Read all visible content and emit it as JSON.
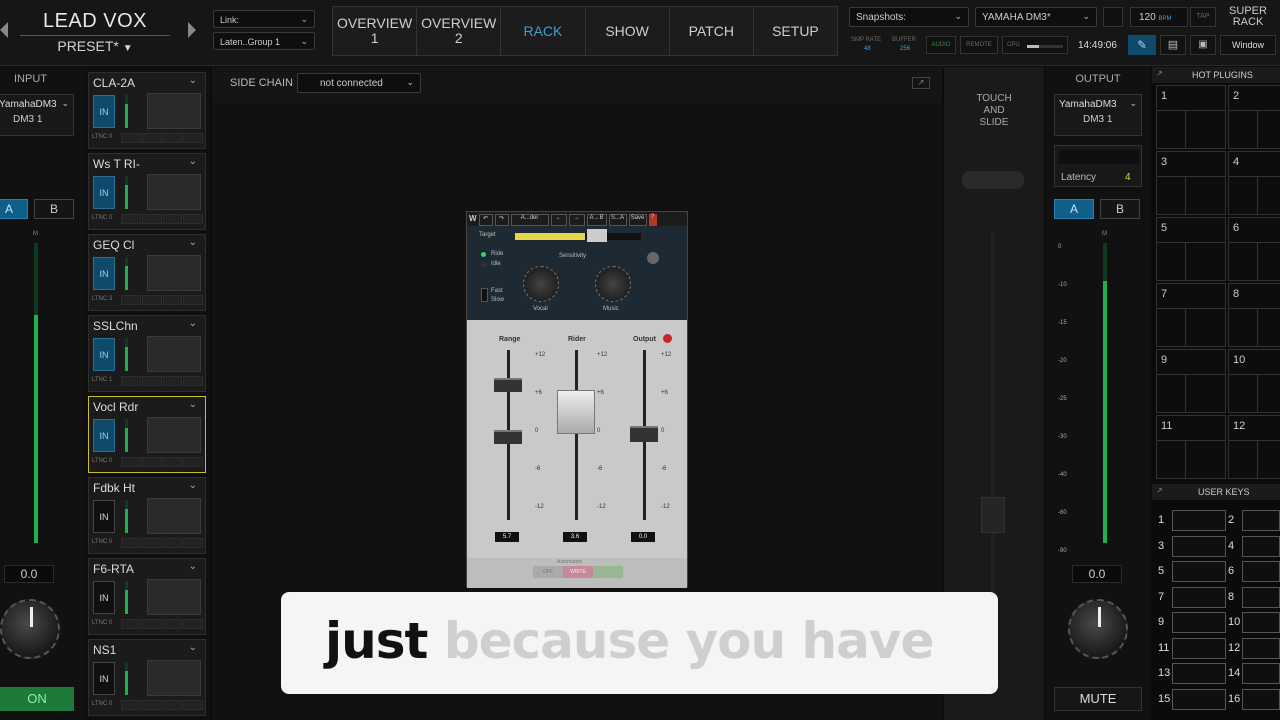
{
  "header": {
    "preset_title": "LEAD VOX",
    "preset_sub": "PRESET*",
    "link_label": "Link:",
    "link_value": "Laten..Group 1",
    "tabs": [
      {
        "line1": "OVERVIEW",
        "line2": "1"
      },
      {
        "line1": "OVERVIEW",
        "line2": "2"
      },
      {
        "line1": "RACK",
        "line2": ""
      },
      {
        "line1": "SHOW",
        "line2": ""
      },
      {
        "line1": "PATCH",
        "line2": ""
      },
      {
        "line1": "SETUP",
        "line2": ""
      }
    ],
    "snapshots_label": "Snapshots:",
    "device_label": "YAMAHA DM3*",
    "bpm_value": "120",
    "bpm_label": "BPM",
    "tap_label": "TAP",
    "super_rack_l1": "SUPER",
    "super_rack_l2": "RACK",
    "smp_rate_label": "SMP RATE",
    "smp_rate_value": "48",
    "buffer_label": "BUFFER",
    "buffer_value": "256",
    "audio_label": "AUDIO",
    "remote_label": "REMOTE",
    "cpu_label": "CPU",
    "clock": "14:49:06",
    "window_label": "Window"
  },
  "input": {
    "title": "INPUT",
    "device": "YamahaDM3",
    "device_sub": "DM3 1",
    "a_label": "A",
    "b_label": "B",
    "m_label": "M",
    "gain": "0.0",
    "on_label": "ON"
  },
  "rack": {
    "in_label": "IN",
    "slots": [
      {
        "name": "CLA-2A",
        "ltnc": "LTNC 0"
      },
      {
        "name": "Ws T RI-",
        "ltnc": "LTNC 0"
      },
      {
        "name": "GEQ Cl",
        "ltnc": "LTNC 3"
      },
      {
        "name": "SSLChn",
        "ltnc": "LTNC 1"
      },
      {
        "name": "Vocl Rdr",
        "ltnc": "LTNC 0"
      },
      {
        "name": "Fdbk Ht",
        "ltnc": "LTNC 0"
      },
      {
        "name": "F6-RTA",
        "ltnc": "LTNC 0"
      },
      {
        "name": "NS1",
        "ltnc": "LTNC 0"
      }
    ]
  },
  "sidechain": {
    "label": "SIDE CHAIN",
    "value": "not connected"
  },
  "plugin": {
    "toolbar": [
      "A...der",
      "A→B",
      "S...A",
      "Save"
    ],
    "target_label": "Target",
    "ride_label": "Ride",
    "idle_label": "Idle",
    "fast_label": "Fast",
    "slow_label": "Slow",
    "sensitivity_label": "Sensitivity",
    "vocal_label": "Vocal",
    "music_label": "Music",
    "range_label": "Range",
    "rider_label": "Rider",
    "output_label": "Output",
    "scale": [
      "+12",
      "+6",
      "0",
      "-6",
      "-12"
    ],
    "range_value": "5.7",
    "rider_value": "3.6",
    "output_value": "0.0",
    "automation_label": "Automation",
    "btns": [
      "OFF",
      "WRITE",
      "READ"
    ]
  },
  "touch": {
    "line1": "TOUCH",
    "line2": "AND",
    "line3": "SLIDE"
  },
  "output": {
    "title": "OUTPUT",
    "device": "YamahaDM3",
    "device_sub": "DM3 1",
    "latency_label": "Latency",
    "latency_value": "4",
    "a_label": "A",
    "b_label": "B",
    "m_label": "M",
    "scale": [
      "0",
      "-10",
      "-15",
      "-20",
      "-25",
      "-30",
      "-40",
      "-60",
      "-90"
    ],
    "gain": "0.0",
    "mute_label": "MUTE"
  },
  "hot_plugins": {
    "title": "HOT PLUGINS",
    "numbers": [
      "1",
      "2",
      "3",
      "4",
      "5",
      "6",
      "7",
      "8",
      "9",
      "10",
      "11",
      "12"
    ]
  },
  "user_keys": {
    "title": "USER KEYS",
    "numbers": [
      "1",
      "2",
      "3",
      "4",
      "5",
      "6",
      "7",
      "8",
      "9",
      "10",
      "11",
      "12",
      "13",
      "14",
      "15",
      "16"
    ]
  },
  "caption": {
    "spoken": "just",
    "upcoming": "because you have"
  },
  "colors": {
    "accent": "#3aa0e0",
    "meter_green": "#1fb04f",
    "selected_slot": "#c9bf2a",
    "on_green": "#1e7a3a"
  }
}
